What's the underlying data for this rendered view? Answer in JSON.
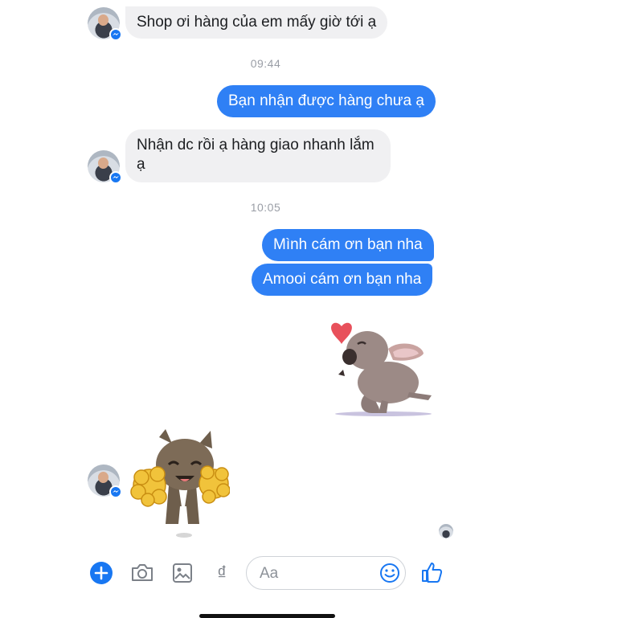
{
  "messages": {
    "m1": "Shop ơi hàng của em mấy giờ tới ạ",
    "t1": "09:44",
    "m2": "Bạn nhận được hàng chưa ạ",
    "m3_line1": "Nhận dc rồi ạ hàng giao nhanh lắm",
    "m3_line2": "ạ",
    "t2": "10:05",
    "m4": "Mình cám ơn bạn nha",
    "m5": "Amooi cám ơn bạn nha"
  },
  "composer": {
    "placeholder": "Aa",
    "currency_symbol": "₫"
  },
  "colors": {
    "outgoing": "#2f80f5",
    "incoming": "#f0f0f2",
    "accent": "#1877f2"
  },
  "icons": [
    "messenger-badge-icon",
    "plus-icon",
    "camera-icon",
    "image-icon",
    "dong-icon",
    "emoji-icon",
    "like-icon"
  ]
}
